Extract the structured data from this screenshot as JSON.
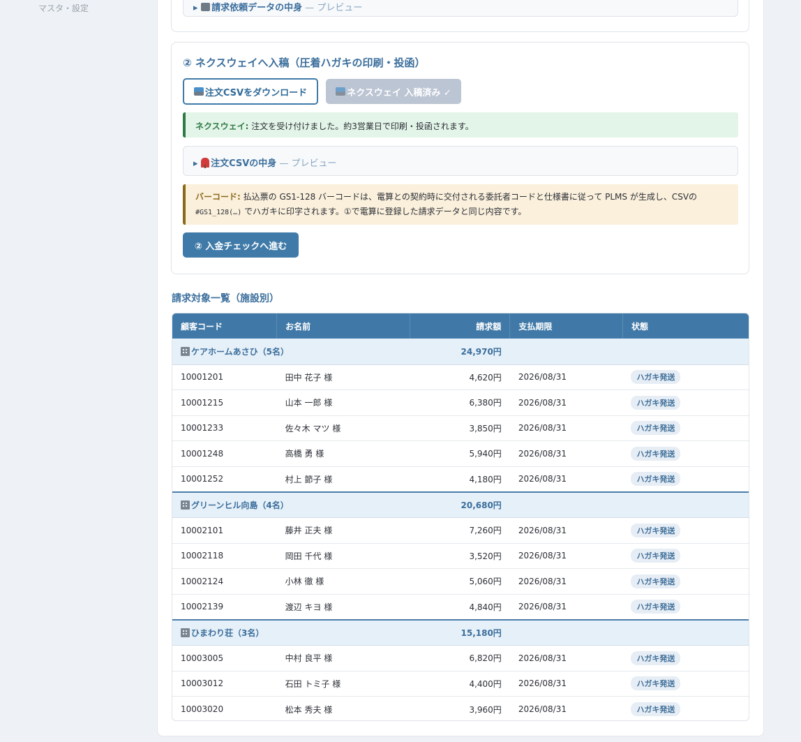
{
  "sidebar": {
    "last_item": "マスタ・設定"
  },
  "step1": {
    "details_title": "請求依頼データの中身",
    "details_suffix": " — プレビュー"
  },
  "step2": {
    "title": "② ネクスウェイへ入稿（圧着ハガキの印刷・投函）",
    "download_button": "注文CSVをダウンロード",
    "submitted_button": "ネクスウェイ 入稿済み ✓",
    "success_label": "ネクスウェイ:",
    "success_text": " 注文を受け付けました。約3営業日で印刷・投函されます。",
    "csv_details_title": "注文CSVの中身",
    "csv_details_suffix": " — プレビュー",
    "barcode_label": "バーコード:",
    "barcode_text_1": " 払込票の GS1-128 バーコードは、電算との契約時に交付される委託者コードと仕様書に従って PLMS が生成し、CSVの ",
    "barcode_code": "#GS1_128(…)",
    "barcode_text_2": " でハガキに印字されます。①で電算に登録した請求データと同じ内容です。",
    "next_button": "② 入金チェックへ進む"
  },
  "billing": {
    "section_title": "請求対象一覧（施設別）",
    "headers": [
      "顧客コード",
      "お名前",
      "請求額",
      "支払期限",
      "状態"
    ],
    "groups": [
      {
        "name": "ケアホームあさひ（5名）",
        "total": "24,970円",
        "rows": [
          [
            "10001201",
            "田中 花子 様",
            "4,620円",
            "2026/08/31",
            "ハガキ発送"
          ],
          [
            "10001215",
            "山本 一郎 様",
            "6,380円",
            "2026/08/31",
            "ハガキ発送"
          ],
          [
            "10001233",
            "佐々木 マツ 様",
            "3,850円",
            "2026/08/31",
            "ハガキ発送"
          ],
          [
            "10001248",
            "高橋 勇 様",
            "5,940円",
            "2026/08/31",
            "ハガキ発送"
          ],
          [
            "10001252",
            "村上 節子 様",
            "4,180円",
            "2026/08/31",
            "ハガキ発送"
          ]
        ]
      },
      {
        "name": "グリーンヒル向島（4名）",
        "total": "20,680円",
        "rows": [
          [
            "10002101",
            "藤井 正夫 様",
            "7,260円",
            "2026/08/31",
            "ハガキ発送"
          ],
          [
            "10002118",
            "岡田 千代 様",
            "3,520円",
            "2026/08/31",
            "ハガキ発送"
          ],
          [
            "10002124",
            "小林 徹 様",
            "5,060円",
            "2026/08/31",
            "ハガキ発送"
          ],
          [
            "10002139",
            "渡辺 キヨ 様",
            "4,840円",
            "2026/08/31",
            "ハガキ発送"
          ]
        ]
      },
      {
        "name": "ひまわり荘（3名）",
        "total": "15,180円",
        "rows": [
          [
            "10003005",
            "中村 良平 様",
            "6,820円",
            "2026/08/31",
            "ハガキ発送"
          ],
          [
            "10003012",
            "石田 トミ子 様",
            "4,400円",
            "2026/08/31",
            "ハガキ発送"
          ],
          [
            "10003020",
            "松本 秀夫 様",
            "3,960円",
            "2026/08/31",
            "ハガキ発送"
          ]
        ]
      }
    ]
  },
  "colors": {
    "primary": "#3f7aa8",
    "success": "#2f7a45",
    "warning": "#8a6a1a"
  }
}
